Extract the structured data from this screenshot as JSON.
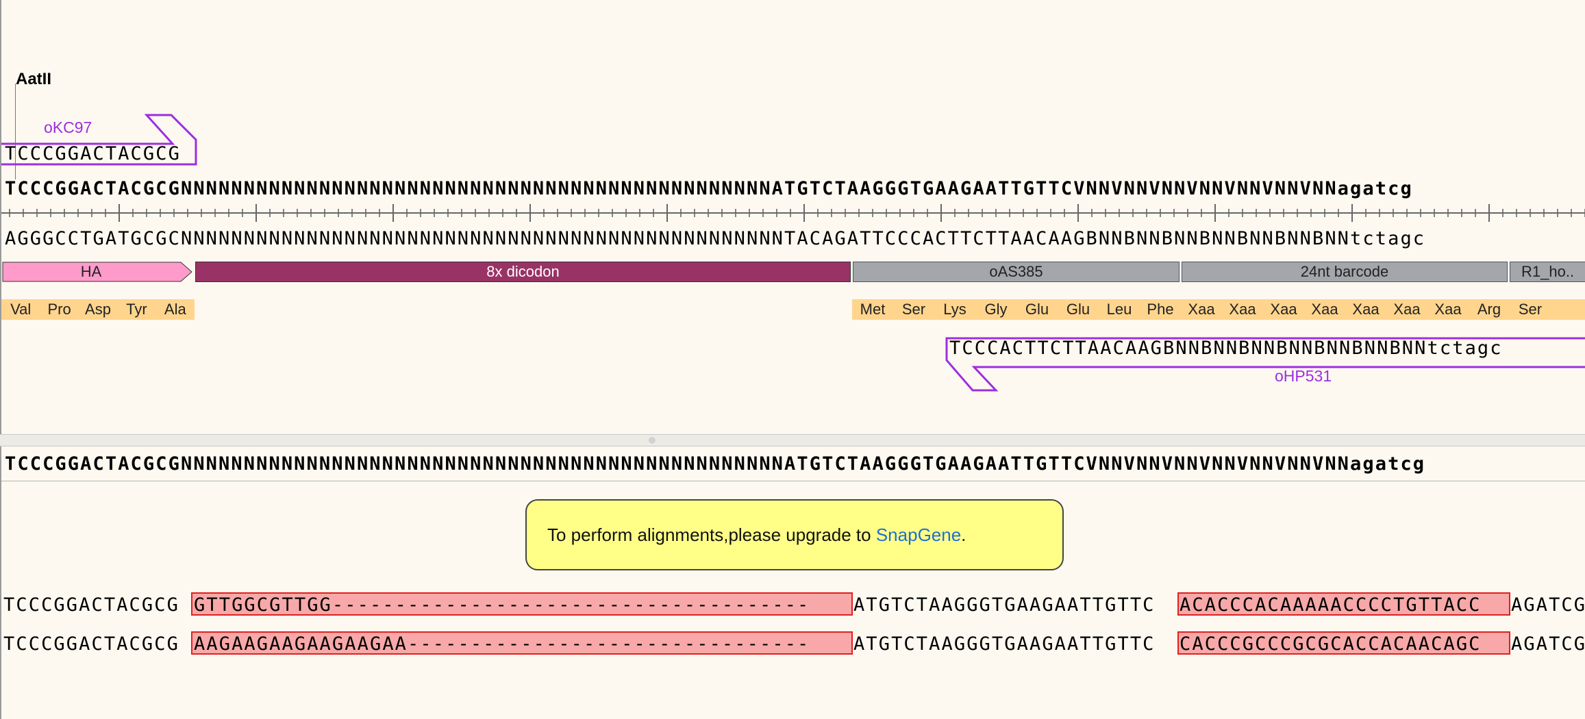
{
  "top_view": {
    "enzyme_label": "AatII",
    "primer_forward": {
      "name": "oKC97",
      "sequence": "TCCCGGACTACGCG",
      "color": "#9d2ee0"
    },
    "primer_reverse": {
      "name": "oHP531",
      "sequence": "TCCCACTTCTTAACAAGBNNBNNBNNBNNBNNBNNBNNtctagc",
      "color": "#9d2ee0"
    },
    "top_strand": "TCCCGGACTACGCGNNNNNNNNNNNNNNNNNNNNNNNNNNNNNNNNNNNNNNNNNNNNNNNATGTCTAAGGGTGAAGAATTGTTCVNNVNNVNNVNNVNNVNNVNNagatcg",
    "bottom_strand": "AGGGCCTGATGCGCNNNNNNNNNNNNNNNNNNNNNNNNNNNNNNNNNNNNNNNNNNNNNNNNTACAGATTCCCACTTCTTAACAAGBNNBNNBNNBNNBNNBNNBNNtctagc",
    "features": [
      {
        "name": "HA",
        "color": "#ff9bcb"
      },
      {
        "name": "8x dicodon",
        "color": "#993366"
      },
      {
        "name": "oAS385",
        "color": "#a3a6ab"
      },
      {
        "name": "24nt barcode",
        "color": "#a3a6ab"
      },
      {
        "name": "R1_ho..",
        "color": "#a3a6ab"
      }
    ],
    "translation_left": [
      "Val",
      "Pro",
      "Asp",
      "Tyr",
      "Ala"
    ],
    "translation_right": [
      "Met",
      "Ser",
      "Lys",
      "Gly",
      "Glu",
      "Glu",
      "Leu",
      "Phe",
      "Xaa",
      "Xaa",
      "Xaa",
      "Xaa",
      "Xaa",
      "Xaa",
      "Xaa",
      "Arg",
      "Ser"
    ]
  },
  "alignment_view": {
    "reference": "TCCCGGACTACGCGNNNNNNNNNNNNNNNNNNNNNNNNNNNNNNNNNNNNNNNNNNNNNNNNATGTCTAAGGGTGAAGAATTGTTCVNNVNNVNNVNNVNNVNNVNNagatcg",
    "upgrade_message": "To perform alignments,please upgrade to ",
    "upgrade_link": "SnapGene",
    "upgrade_period": ".",
    "reads": [
      {
        "prefix": "TCCCGGACTACGCG",
        "insert": "GTTGGCGTTGG--------------------------------------",
        "middle": "ATGTCTAAGGGTGAAGAATTGTTC",
        "barcode": "ACACCCACAAAAACCCCTGTTACC",
        "suffix": "AGATCG"
      },
      {
        "prefix": "TCCCGGACTACGCG",
        "insert": "AAGAAGAAGAAGAAGAA--------------------------------",
        "middle": "ATGTCTAAGGGTGAAGAATTGTTC",
        "barcode": "CACCCGCCCGCGCACCACAACAGC",
        "suffix": "AGATCG"
      }
    ]
  }
}
